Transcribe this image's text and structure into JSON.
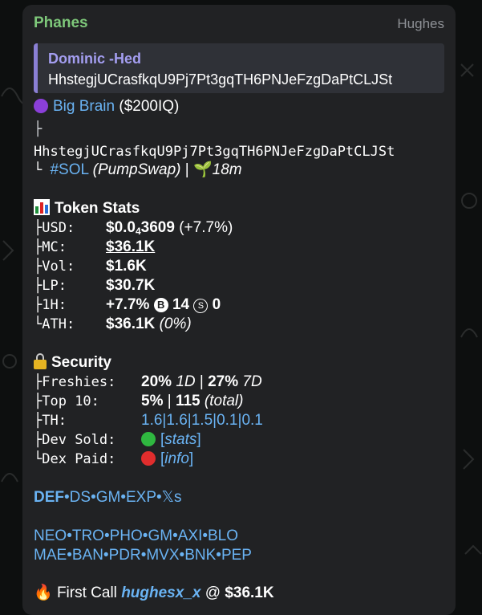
{
  "message": {
    "sender": "Phanes",
    "signature": "Hughes",
    "reply": {
      "author": "Dominic -Hed",
      "text": "HhstegjUCrasfkqU9Pj7Pt3gqTH6PNJeFzgDaPtCLJSt"
    },
    "token": {
      "name": "Big Brain",
      "ticker": "($200IQ)",
      "address": "HhstegjUCrasfkqU9Pj7Pt3gqTH6PNJeFzgDaPtCLJSt",
      "chain_tag": "#SOL",
      "dex": "(PumpSwap)",
      "separator": "|",
      "age": "18m"
    },
    "stats": {
      "title": "Token Stats",
      "usd_label": "USD:",
      "usd_value_prefix": "$0.0",
      "usd_value_sub": "4",
      "usd_value_rest": "3609",
      "usd_change": "(+7.7%)",
      "mc_label": "MC:",
      "mc_value": "$36.1K",
      "vol_label": "Vol:",
      "vol_value": "$1.6K",
      "lp_label": "LP:",
      "lp_value": "$30.7K",
      "h1_label": "1H:",
      "h1_change": "+7.7%",
      "h1_buy_badge": "B",
      "h1_buys": "14",
      "h1_sell_badge": "S",
      "h1_sells": "0",
      "ath_label": "ATH:",
      "ath_value": "$36.1K",
      "ath_pct": "(0%)"
    },
    "security": {
      "title": "Security",
      "freshies_label": "Freshies:",
      "freshies_1d": "20%",
      "freshies_1d_suffix": "1D",
      "freshies_sep": "|",
      "freshies_7d": "27%",
      "freshies_7d_suffix": "7D",
      "top10_label": "Top 10:",
      "top10_pct": "5%",
      "top10_sep": "|",
      "top10_total": "115",
      "top10_total_suffix": "(total)",
      "th_label": "TH:",
      "th_values": [
        "1.6",
        "1.6",
        "1.5",
        "0.1",
        "0.1"
      ],
      "dev_sold_label": "Dev Sold:",
      "dev_sold_link": "stats",
      "dex_paid_label": "Dex Paid:",
      "dex_paid_link": "info"
    },
    "links_row1": [
      "DEF",
      "DS",
      "GM",
      "EXP",
      "𝕏s"
    ],
    "links_row2": [
      "NEO",
      "TRO",
      "PHO",
      "GM",
      "AXI",
      "BLO"
    ],
    "links_row3": [
      "MAE",
      "BAN",
      "PDR",
      "MVX",
      "BNK",
      "PEP"
    ],
    "first_call": {
      "label": "First Call",
      "user": "hughesx_x",
      "at": "@",
      "value": "$36.1K"
    }
  },
  "colors": {
    "bubble": "#212224",
    "sender": "#7ec87a",
    "link": "#6ab3f3",
    "reply_accent": "#8a7fd4"
  },
  "icons": [
    "purple-circle-icon",
    "chart-icon",
    "lock-icon",
    "green-circle-icon",
    "red-circle-icon",
    "fire-icon",
    "seedling-icon"
  ]
}
